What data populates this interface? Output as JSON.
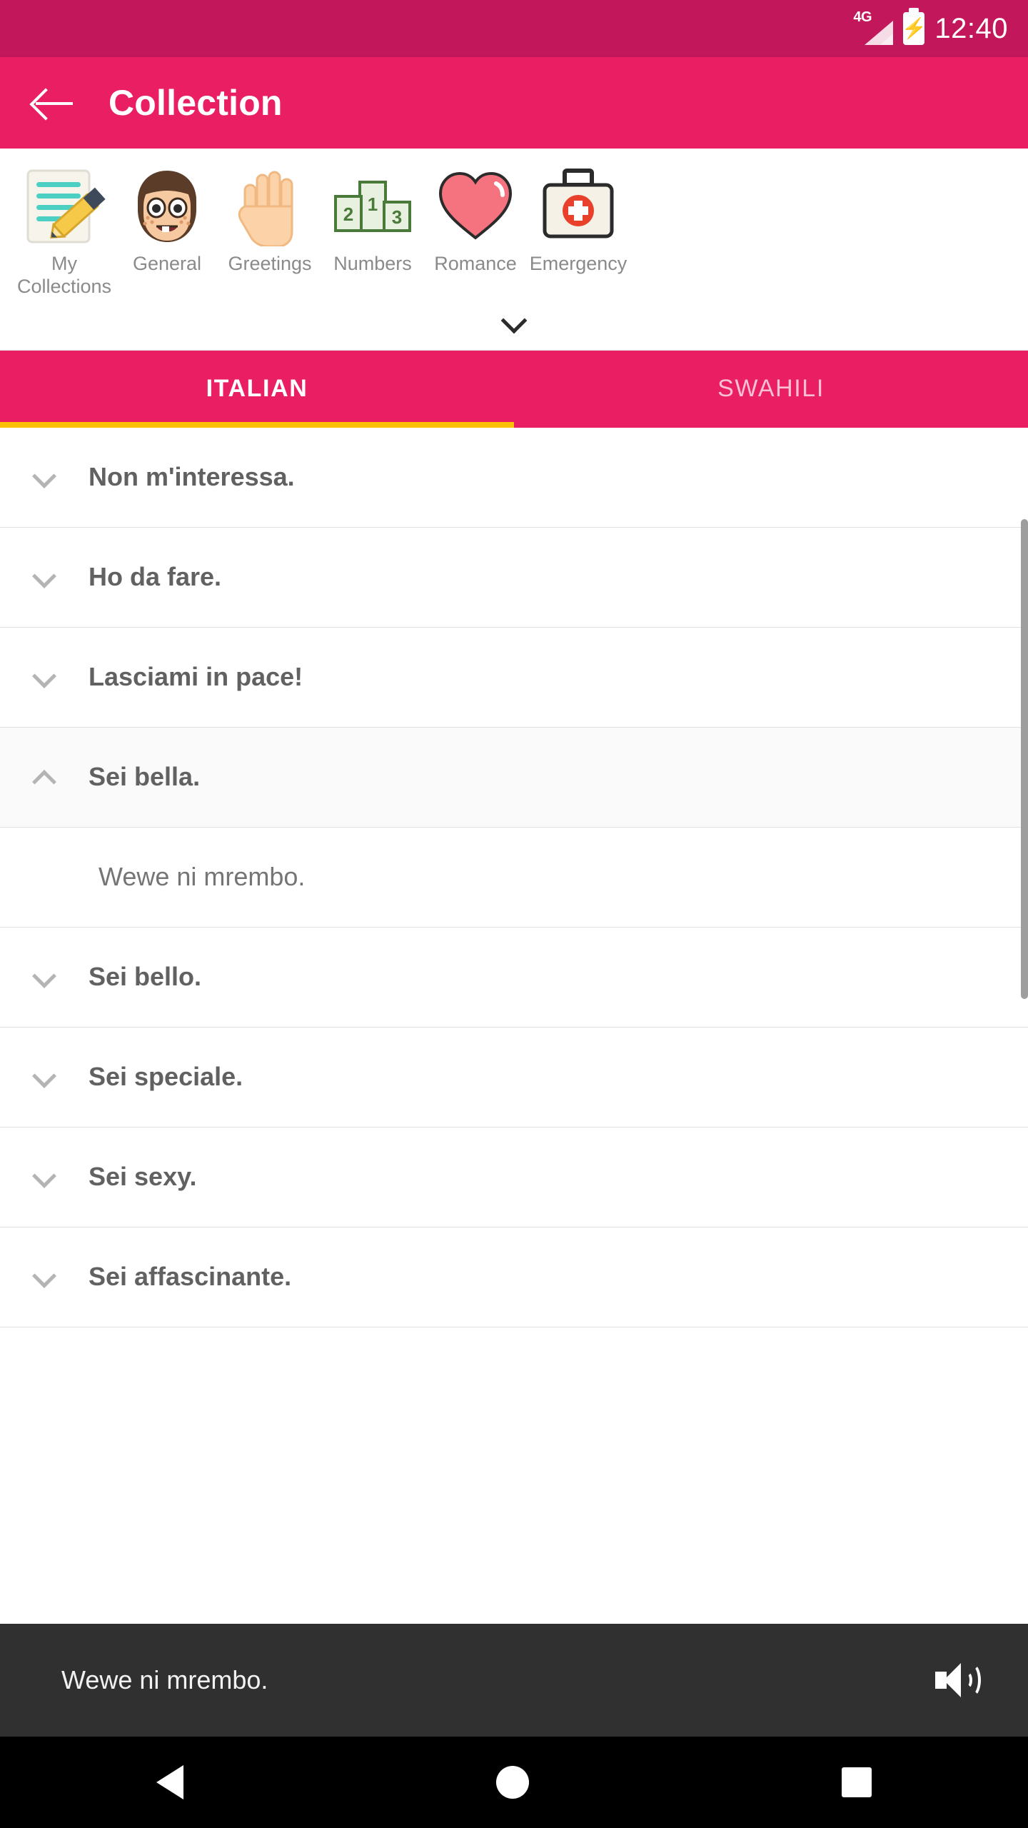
{
  "status_bar": {
    "network": "4G",
    "time": "12:40"
  },
  "app_bar": {
    "title": "Collection",
    "back_icon": "arrow-left-icon"
  },
  "categories": [
    {
      "label": "My Collections",
      "icon": "notepad-pencil-icon"
    },
    {
      "label": "General",
      "icon": "girl-face-icon"
    },
    {
      "label": "Greetings",
      "icon": "raised-hand-icon"
    },
    {
      "label": "Numbers",
      "icon": "podium-icon"
    },
    {
      "label": "Romance",
      "icon": "heart-icon"
    },
    {
      "label": "Emergency",
      "icon": "first-aid-kit-icon"
    }
  ],
  "category_expand": {
    "icon": "chevron-down-icon"
  },
  "tabs": [
    {
      "label": "ITALIAN",
      "active": true
    },
    {
      "label": "SWAHILI",
      "active": false
    }
  ],
  "phrases": [
    {
      "text": "Non m'interessa.",
      "expanded": false,
      "translation": ""
    },
    {
      "text": "Ho da fare.",
      "expanded": false,
      "translation": ""
    },
    {
      "text": "Lasciami in pace!",
      "expanded": false,
      "translation": ""
    },
    {
      "text": "Sei bella.",
      "expanded": true,
      "translation": "Wewe ni mrembo."
    },
    {
      "text": "Sei bello.",
      "expanded": false,
      "translation": ""
    },
    {
      "text": "Sei speciale.",
      "expanded": false,
      "translation": ""
    },
    {
      "text": "Sei sexy.",
      "expanded": false,
      "translation": ""
    },
    {
      "text": "Sei affascinante.",
      "expanded": false,
      "translation": ""
    }
  ],
  "player": {
    "text": "Wewe ni mrembo.",
    "icon": "speaker-icon"
  },
  "nav_bar": {
    "back": "triangle-back-icon",
    "home": "circle-home-icon",
    "recents": "square-recents-icon"
  },
  "colors": {
    "status_bar": "#c2185b",
    "app_bar": "#e91e63",
    "tab_bar": "#e91e63",
    "tab_indicator": "#ffc107",
    "player_bg": "#303030",
    "nav_bg": "#000000"
  }
}
